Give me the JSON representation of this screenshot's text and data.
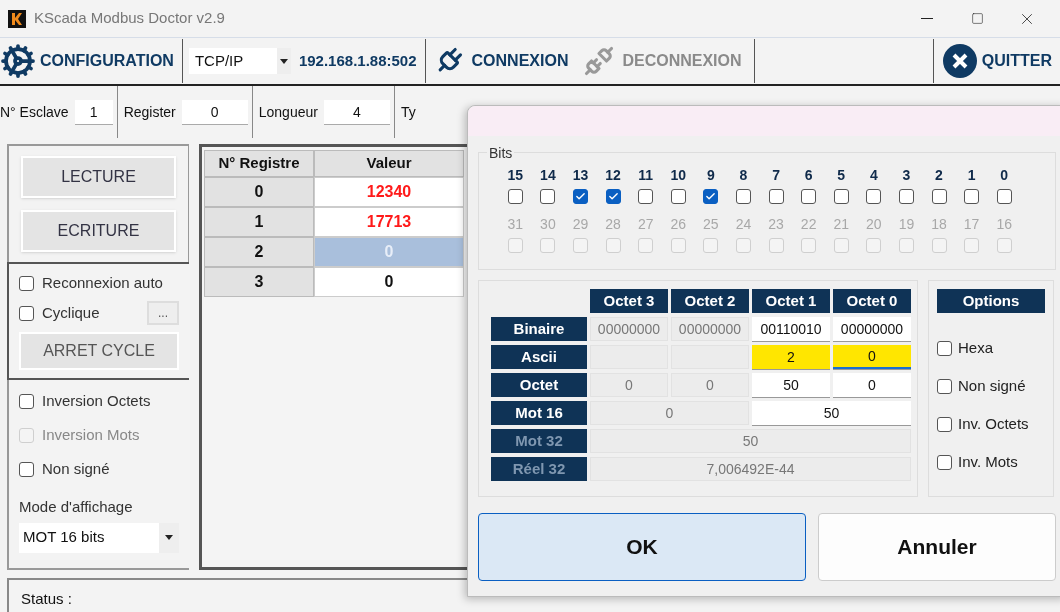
{
  "window": {
    "title": "KScada Modbus Doctor v2.9"
  },
  "toolbar": {
    "configuration": "CONFIGURATION",
    "protocol": "TCP/IP",
    "address": "192.168.1.88:502",
    "actions": [
      {
        "label": "CONNEXION",
        "kind": "connect",
        "disabled": false
      },
      {
        "label": "DECONNEXION",
        "kind": "disconnect",
        "disabled": true
      }
    ],
    "quit": "QUITTER"
  },
  "params": [
    {
      "label": "N° Esclave",
      "value": "1"
    },
    {
      "label": "Register",
      "value": "0"
    },
    {
      "label": "Longueur",
      "value": "4"
    }
  ],
  "params_cut_label": "Ty",
  "left_panel": {
    "read": "LECTURE",
    "write": "ECRITURE",
    "cycle_options": [
      {
        "label": "Reconnexion auto",
        "checked": false
      },
      {
        "label": "Cyclique",
        "checked": false
      }
    ],
    "cycle_settings": "...",
    "stop_cycle": "ARRET CYCLE",
    "options": [
      {
        "label": "Inversion Octets",
        "checked": false,
        "disabled": false
      },
      {
        "label": "Inversion Mots",
        "checked": false,
        "disabled": true
      },
      {
        "label": "Non signé",
        "checked": false,
        "disabled": false
      }
    ],
    "display_mode_label": "Mode d'affichage",
    "display_mode": "MOT 16 bits"
  },
  "table": {
    "columns": [
      "N° Registre",
      "Valeur"
    ],
    "rows": [
      {
        "register": "0",
        "value": "12340",
        "changed": true,
        "selected": false
      },
      {
        "register": "1",
        "value": "17713",
        "changed": true,
        "selected": false
      },
      {
        "register": "2",
        "value": "0",
        "changed": false,
        "selected": true
      },
      {
        "register": "3",
        "value": "0",
        "changed": false,
        "selected": false
      }
    ]
  },
  "status": "Status :",
  "dialog": {
    "bits_title": "Bits",
    "bit_rows": [
      {
        "disabled": false,
        "bits": [
          {
            "label": "15",
            "checked": false
          },
          {
            "label": "14",
            "checked": false
          },
          {
            "label": "13",
            "checked": true
          },
          {
            "label": "12",
            "checked": true
          },
          {
            "label": "11",
            "checked": false
          },
          {
            "label": "10",
            "checked": false
          },
          {
            "label": "9",
            "checked": true
          },
          {
            "label": "8",
            "checked": false
          },
          {
            "label": "7",
            "checked": false
          },
          {
            "label": "6",
            "checked": false
          },
          {
            "label": "5",
            "checked": false
          },
          {
            "label": "4",
            "checked": false
          },
          {
            "label": "3",
            "checked": false
          },
          {
            "label": "2",
            "checked": false
          },
          {
            "label": "1",
            "checked": false
          },
          {
            "label": "0",
            "checked": false
          }
        ]
      },
      {
        "disabled": true,
        "bits": [
          {
            "label": "31",
            "checked": false
          },
          {
            "label": "30",
            "checked": false
          },
          {
            "label": "29",
            "checked": false
          },
          {
            "label": "28",
            "checked": false
          },
          {
            "label": "27",
            "checked": false
          },
          {
            "label": "26",
            "checked": false
          },
          {
            "label": "25",
            "checked": false
          },
          {
            "label": "24",
            "checked": false
          },
          {
            "label": "23",
            "checked": false
          },
          {
            "label": "22",
            "checked": false
          },
          {
            "label": "21",
            "checked": false
          },
          {
            "label": "20",
            "checked": false
          },
          {
            "label": "19",
            "checked": false
          },
          {
            "label": "18",
            "checked": false
          },
          {
            "label": "17",
            "checked": false
          },
          {
            "label": "16",
            "checked": false
          }
        ]
      }
    ],
    "columns": [
      "Octet 3",
      "Octet 2",
      "Octet 1",
      "Octet 0"
    ],
    "rows": [
      {
        "label": "Binaire",
        "kind": "bytes",
        "disabled": false,
        "cells": [
          {
            "value": "00000000",
            "editable": false,
            "highlighted": false,
            "focused": false
          },
          {
            "value": "00000000",
            "editable": false,
            "highlighted": false,
            "focused": false
          },
          {
            "value": "00110010",
            "editable": true,
            "highlighted": false,
            "focused": false
          },
          {
            "value": "00000000",
            "editable": true,
            "highlighted": false,
            "focused": false
          }
        ]
      },
      {
        "label": "Ascii",
        "kind": "bytes",
        "disabled": false,
        "cells": [
          {
            "editable": false,
            "highlighted": false,
            "focused": false
          },
          {
            "editable": false,
            "highlighted": false,
            "focused": false
          },
          {
            "value": "2",
            "editable": true,
            "highlighted": true,
            "focused": false
          },
          {
            "value": "0",
            "editable": true,
            "highlighted": true,
            "focused": true
          }
        ]
      },
      {
        "label": "Octet",
        "kind": "bytes",
        "disabled": false,
        "cells": [
          {
            "value": "0",
            "editable": false,
            "highlighted": false,
            "focused": false
          },
          {
            "value": "0",
            "editable": false,
            "highlighted": false,
            "focused": false
          },
          {
            "value": "50",
            "editable": true,
            "highlighted": false,
            "focused": false
          },
          {
            "value": "0",
            "editable": true,
            "highlighted": false,
            "focused": false
          }
        ]
      },
      {
        "label": "Mot 16",
        "kind": "words",
        "disabled": false,
        "cells": [
          {
            "value": "0",
            "editable": false,
            "highlighted": false,
            "focused": false
          },
          {
            "value": "50",
            "editable": true,
            "highlighted": false,
            "focused": false
          }
        ]
      },
      {
        "label": "Mot 32",
        "kind": "dword",
        "disabled": true,
        "cells": [
          {
            "value": "50",
            "editable": false,
            "highlighted": false,
            "focused": false
          }
        ]
      },
      {
        "label": "Réel 32",
        "kind": "dword",
        "disabled": true,
        "cells": [
          {
            "value": "7,006492E-44",
            "editable": false,
            "highlighted": false,
            "focused": false
          }
        ]
      }
    ],
    "options_title": "Options",
    "options": [
      {
        "label": "Hexa",
        "checked": false
      },
      {
        "label": "Non signé",
        "checked": false
      },
      {
        "label": "Inv. Octets",
        "checked": false
      },
      {
        "label": "Inv. Mots",
        "checked": false
      }
    ],
    "ok": "OK",
    "cancel": "Annuler"
  }
}
